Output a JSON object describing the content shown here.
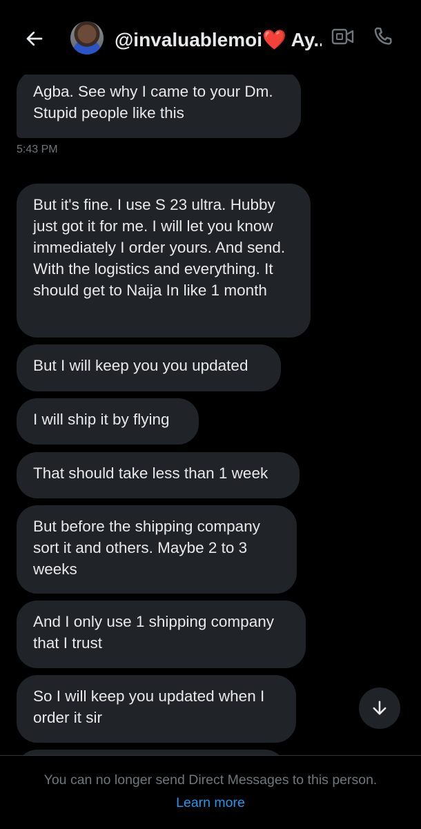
{
  "header": {
    "contact_handle": "@invaluablemoi",
    "contact_name_trunc": "Ay..."
  },
  "messages": [
    {
      "text": "Agba. See why I came to your Dm. Stupid people like this"
    },
    {
      "text": "But it's fine. I use S 23 ultra. Hubby just got it for me. I will let you know immediately I order yours. And send. With the logistics and everything.  It should get to Naija In like 1 month"
    },
    {
      "text": "But I will keep you you updated"
    },
    {
      "text": "I will ship it by flying"
    },
    {
      "text": "That should take less than 1 week"
    },
    {
      "text": "But before the shipping company sort it and others. Maybe 2 to 3 weeks"
    },
    {
      "text": "And I only use 1 shipping company that I trust"
    },
    {
      "text": "So I will keep you updated when I order it sir"
    }
  ],
  "timestamp": "5:43 PM",
  "footer": {
    "notice": "You can no longer send Direct Messages to this person.",
    "link": "Learn more"
  },
  "colors": {
    "background": "#000000",
    "bubble": "#202327",
    "text": "#e7e9ea",
    "muted": "#71767b",
    "link": "#1d9bf0",
    "heart": "#e0245e"
  },
  "icons": [
    "back-arrow-icon",
    "heart-icon",
    "video-camera-icon",
    "phone-icon",
    "arrow-down-icon"
  ]
}
